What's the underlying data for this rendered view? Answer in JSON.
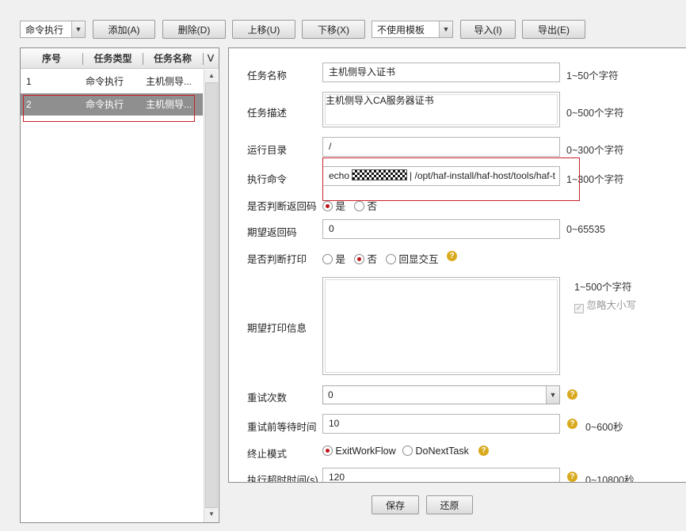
{
  "toolbar": {
    "type_select": "命令执行",
    "add": "添加(A)",
    "delete": "删除(D)",
    "move_up": "上移(U)",
    "move_down": "下移(X)",
    "template_select": "不使用模板",
    "import": "导入(I)",
    "export": "导出(E)"
  },
  "task_list": {
    "columns": [
      "序号",
      "任务类型",
      "任务名称"
    ],
    "rows": [
      {
        "index": "1",
        "type": "命令执行",
        "name": "主机侧导..."
      },
      {
        "index": "2",
        "type": "命令执行",
        "name": "主机侧导..."
      }
    ],
    "selected_row": 2
  },
  "form": {
    "task_name": {
      "label": "任务名称",
      "value": "主机侧导入证书",
      "hint": "1~50个字符"
    },
    "task_desc": {
      "label": "任务描述",
      "value": "主机侧导入CA服务器证书",
      "hint": "0~500个字符"
    },
    "run_dir": {
      "label": "运行目录",
      "value": "/",
      "hint": "0~300个字符"
    },
    "exec_cmd": {
      "label": "执行命令",
      "value_prefix": "echo",
      "value_suffix": "| /opt/haf-install/haf-host/tools/haf-t",
      "hint": "1~300个字符"
    },
    "check_return": {
      "label": "是否判断返回码",
      "options": [
        "是",
        "否"
      ],
      "selected": "是"
    },
    "expected_return": {
      "label": "期望返回码",
      "value": "0",
      "hint": "0~65535"
    },
    "check_print": {
      "label": "是否判断打印",
      "options": [
        "是",
        "否",
        "回显交互"
      ],
      "selected": "否"
    },
    "expected_print": {
      "label": "期望打印信息",
      "value": "",
      "hint": "1~500个字符",
      "ignore_case": "忽略大小写"
    },
    "retry_count": {
      "label": "重试次数",
      "value": "0"
    },
    "retry_wait": {
      "label": "重试前等待时间",
      "value": "10",
      "hint": "0~600秒"
    },
    "stop_mode": {
      "label": "终止模式",
      "options": [
        "ExitWorkFlow",
        "DoNextTask"
      ],
      "selected": "ExitWorkFlow"
    },
    "exec_timeout": {
      "label": "执行超时时间(s)",
      "value": "120",
      "hint": "0~10800秒"
    }
  },
  "footer": {
    "save": "保存",
    "restore": "还原"
  },
  "colors": {
    "highlight_box": "#c8202a",
    "selected_row": "#8f8f8f",
    "help_icon": "#d9a91e",
    "radio_on": "#c0141b"
  }
}
